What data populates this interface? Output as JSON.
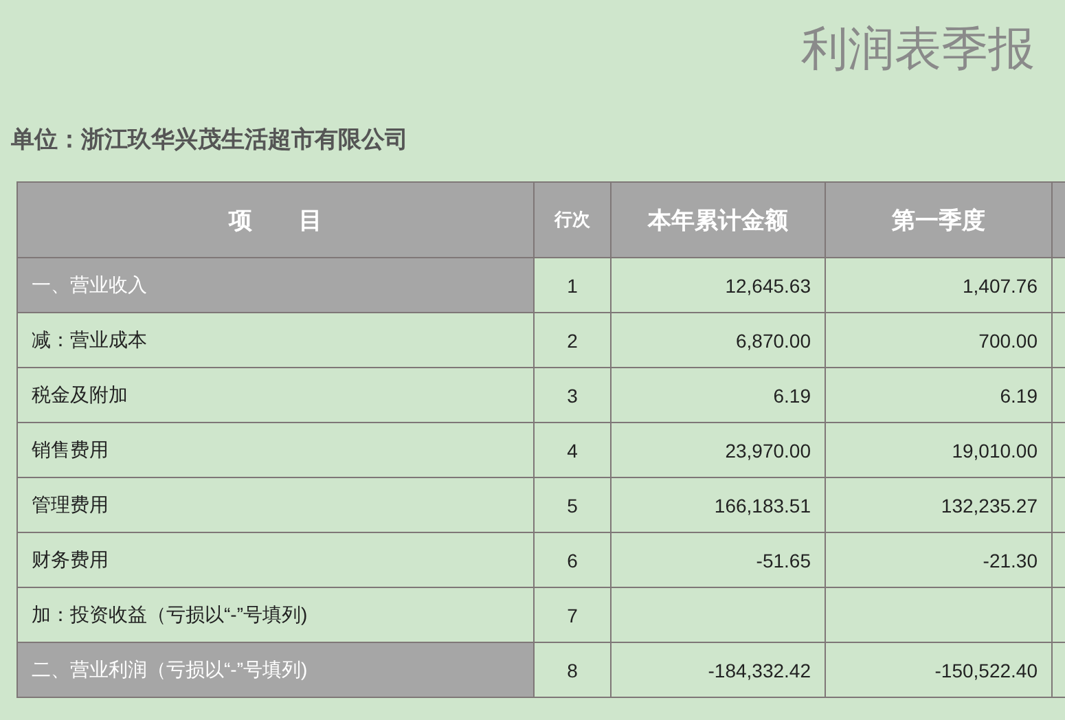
{
  "title": "利润表季报",
  "unit": "单位：浙江玖华兴茂生活超市有限公司",
  "table": {
    "columns": [
      "项　　目",
      "行次",
      "本年累计金额",
      "第一季度"
    ],
    "rows": [
      {
        "kind": "section",
        "item": "一、营业收入",
        "line": "1",
        "ytd": "12,645.63",
        "q1": "1,407.76"
      },
      {
        "kind": "normal",
        "item": "减：营业成本",
        "line": "2",
        "ytd": "6,870.00",
        "q1": "700.00"
      },
      {
        "kind": "normal",
        "item": "税金及附加",
        "line": "3",
        "ytd": "6.19",
        "q1": "6.19"
      },
      {
        "kind": "normal",
        "item": "销售费用",
        "line": "4",
        "ytd": "23,970.00",
        "q1": "19,010.00"
      },
      {
        "kind": "normal",
        "item": "管理费用",
        "line": "5",
        "ytd": "166,183.51",
        "q1": "132,235.27"
      },
      {
        "kind": "normal",
        "item": "财务费用",
        "line": "6",
        "ytd": "-51.65",
        "q1": "-21.30"
      },
      {
        "kind": "normal",
        "item": "加：投资收益（亏损以“-”号填列)",
        "line": "7",
        "ytd": "",
        "q1": ""
      },
      {
        "kind": "section",
        "item": "二、营业利润（亏损以“-”号填列)",
        "line": "8",
        "ytd": "-184,332.42",
        "q1": "-150,522.40"
      }
    ]
  }
}
